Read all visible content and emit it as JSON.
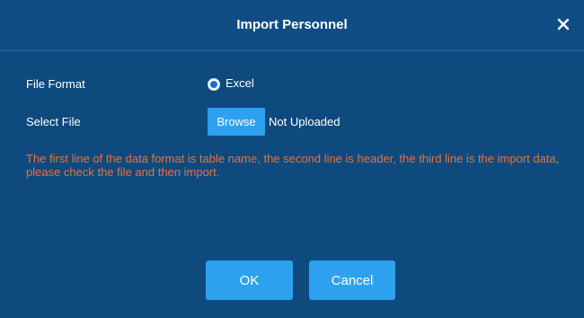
{
  "dialog": {
    "title": "Import Personnel",
    "close_icon": "close-icon",
    "file_format": {
      "label": "File Format",
      "option_label": "Excel",
      "selected": true
    },
    "select_file": {
      "label": "Select File",
      "browse_label": "Browse",
      "status": "Not Uploaded"
    },
    "notice": "The first line of the data format is table name, the second line is header, the third line is the import data, please check the file and then import.",
    "buttons": {
      "ok_label": "OK",
      "cancel_label": "Cancel"
    }
  },
  "colors": {
    "background": "#0e4a7e",
    "accent": "#2ea1ee",
    "notice": "#e8733a",
    "text": "#ffffff"
  }
}
